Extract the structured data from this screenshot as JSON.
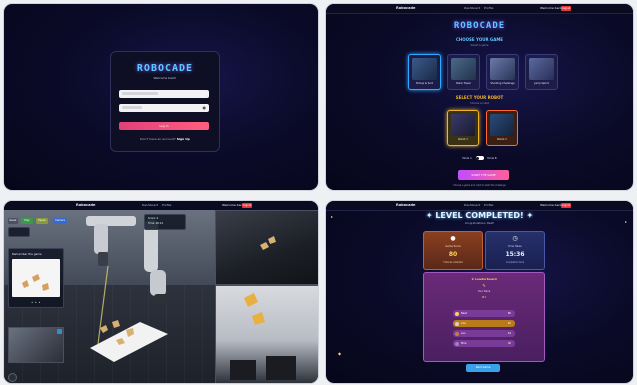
{
  "login": {
    "logo": "ROBOCADE",
    "subtitle": "Welcome back!",
    "login_button": "Log In",
    "signup_prompt": "Don't have an account?",
    "signup_link": "Sign Up",
    "eye_icon": "eye-icon"
  },
  "navbar": {
    "brand": "Robocade",
    "nav_items": [
      "Dashboard",
      "Profile"
    ],
    "user": "Welcome back",
    "logout": "Logout"
  },
  "choose": {
    "logo": "ROBOCADE",
    "choose_title": "CHOOSE YOUR GAME",
    "choose_sub": "Select a game",
    "games": [
      {
        "label": "Pickup & Sort"
      },
      {
        "label": "Stack Tower"
      },
      {
        "label": "Shooting Challenge"
      },
      {
        "label": "Jump Sprint"
      }
    ],
    "robot_title": "SELECT YOUR ROBOT",
    "robot_sub": "Choose a robot",
    "robots": [
      {
        "label": "Robot 1"
      },
      {
        "label": "Robot 2"
      }
    ],
    "toggle_left": "Mode A",
    "toggle_right": "Mode B",
    "start_button": "START THE GAME",
    "start_note": "Choose a game and robot to start the challenge"
  },
  "sim": {
    "brand": "Robocade",
    "nav_items": [
      "Dashboard",
      "Profile"
    ],
    "user": "Welcome back",
    "logout": "Logout",
    "toolbar": [
      "Reset",
      "Play",
      "Pause",
      "Camera"
    ],
    "side_title": "Remember the game",
    "score_label": "Score: 0",
    "time_label": "Time: 00:14"
  },
  "complete": {
    "brand": "Robocade",
    "title": "LEVEL COMPLETED!",
    "subtitle": "Congratulations, Beat!",
    "stat1_label": "Game Score",
    "stat1_value": "80",
    "stat1_foot": "5 Pieces collected",
    "stat2_label": "Time Taken",
    "stat2_value": "15:36",
    "stat2_foot": "Completion time",
    "leaderboard_title": "Leaderboard",
    "your_rank": "Your Rank",
    "rank_value": "#1",
    "leaderboard": [
      {
        "name": "Beat",
        "score": "80"
      },
      {
        "name": "Ana",
        "score": "62"
      },
      {
        "name": "Leo",
        "score": "44"
      },
      {
        "name": "Mira",
        "score": "30"
      }
    ],
    "next_button": "Next Game"
  },
  "colors": {
    "accent_blue": "#5fc6ff",
    "accent_pink": "#ff5f7e",
    "gold": "#f0b429",
    "logout_red": "#e5383b"
  }
}
